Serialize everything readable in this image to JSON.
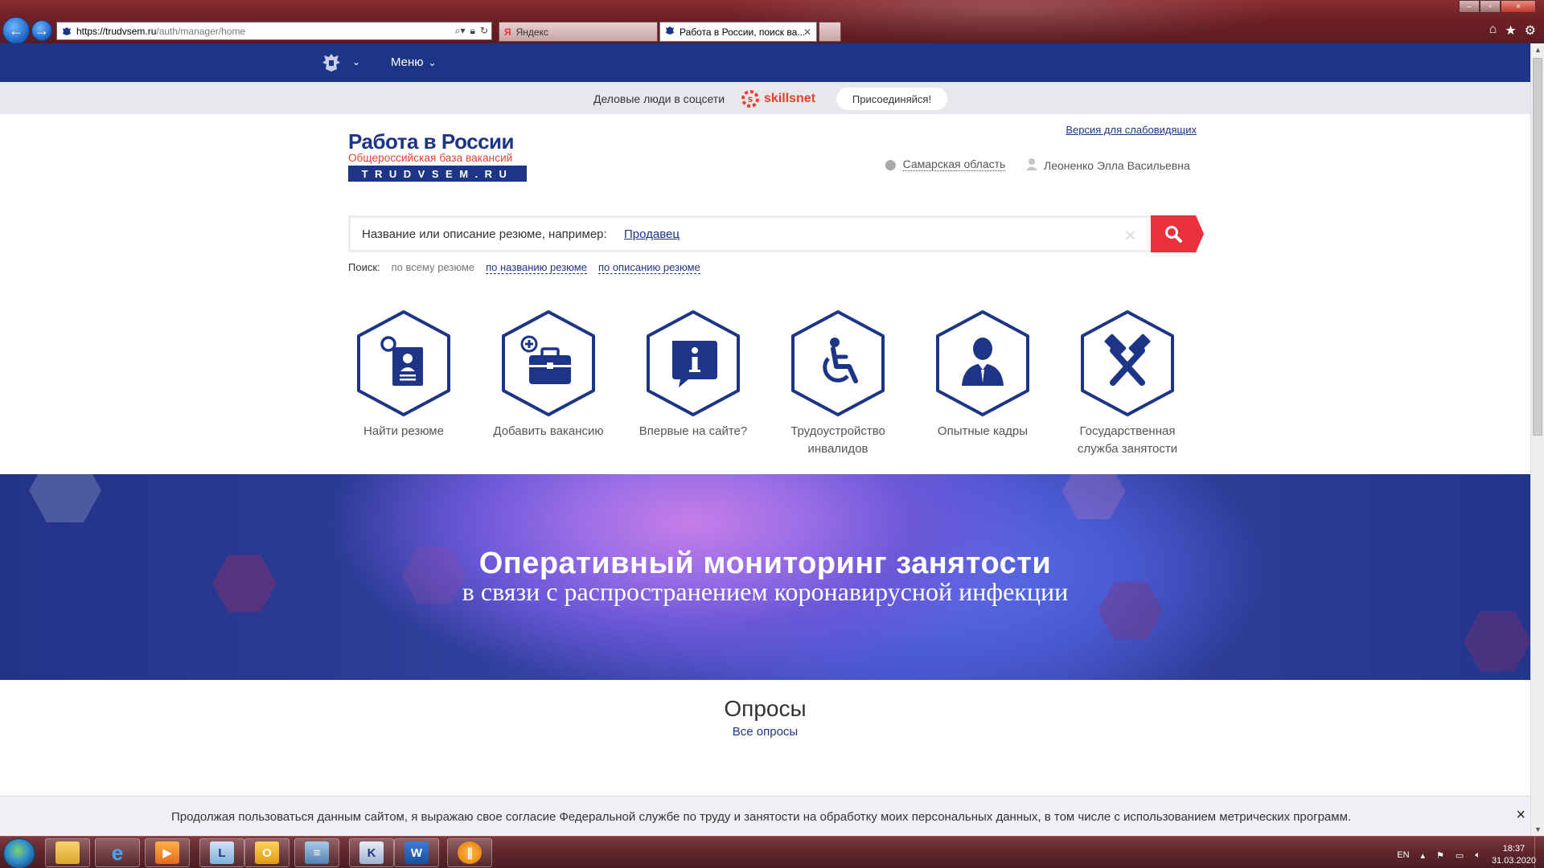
{
  "browser": {
    "url_host": "https://trudvsem.ru",
    "url_path": "/auth/manager/home",
    "tabs": [
      {
        "title": "Яндекс",
        "active": false
      },
      {
        "title": "Работа в России, поиск ва...",
        "active": true
      }
    ],
    "window_controls": [
      "–",
      "▫",
      "×"
    ]
  },
  "topnav": {
    "menu_label": "Меню"
  },
  "promo": {
    "text": "Деловые люди в соцсети",
    "brand": "skillsnet",
    "join_label": "Присоединяйся!"
  },
  "header": {
    "logo_title": "Работа в России",
    "logo_subtitle": "Общероссийская база вакансий",
    "logo_domain": "TRUDVSEM.RU",
    "low_vision_link": "Версия для слабовидящих",
    "region": "Самарская область",
    "user_name": "Леоненко Элла Васильевна"
  },
  "search": {
    "placeholder": "Название или описание резюме, например:",
    "example": "Продавец",
    "options_label": "Поиск:",
    "options": [
      "по всему резюме",
      "по названию резюме",
      "по описанию резюме"
    ]
  },
  "quick_links": [
    {
      "label": "Найти резюме",
      "icon": "find-resume-icon"
    },
    {
      "label": "Добавить вакансию",
      "icon": "add-vacancy-icon"
    },
    {
      "label": "Впервые на сайте?",
      "icon": "info-icon"
    },
    {
      "label": "Трудоустройство инвалидов",
      "icon": "wheelchair-icon"
    },
    {
      "label": "Опытные кадры",
      "icon": "person-icon"
    },
    {
      "label": "Государственная служба занятости",
      "icon": "hammers-icon"
    }
  ],
  "banner": {
    "title": "Оперативный мониторинг занятости",
    "subtitle": "в связи с распространением коронавирусной инфекции"
  },
  "polls": {
    "title": "Опросы",
    "all_link": "Все опросы"
  },
  "cookie_notice": {
    "text": "Продолжая пользоваться данным сайтом, я выражаю свое согласие Федеральной службе по труду и занятости на обработку моих персональных данных, в том числе с использованием метрических программ.",
    "close": "×"
  },
  "taskbar": {
    "language": "EN",
    "time": "18:37",
    "date": "31.03.2020"
  },
  "colors": {
    "brand_blue": "#1d3587",
    "brand_red": "#e8313c"
  }
}
